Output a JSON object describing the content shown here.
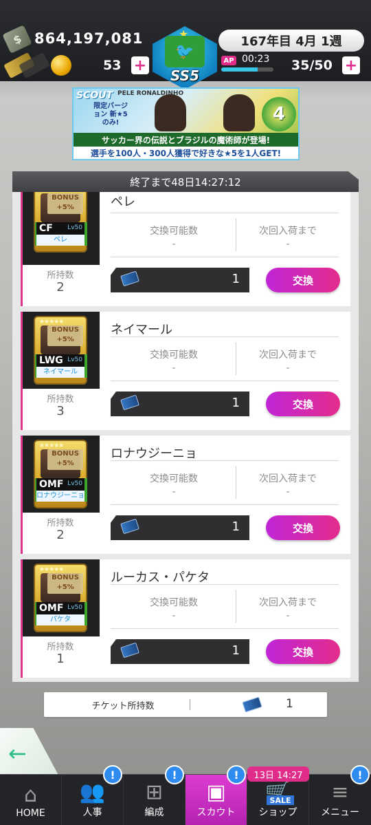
{
  "header": {
    "money": "864,197,081",
    "date": "167年目 4月 1週",
    "coins": "53",
    "ap_label": "AP",
    "ap_timer": "00:23",
    "ap_fraction": 0.7,
    "ap_value": "35/50",
    "emblem_label": "SS5",
    "plus_glyph": "+",
    "icons": {
      "money": "money-icon",
      "ticket": "ticket-icon",
      "coin": "coin-icon"
    }
  },
  "banner": {
    "scout_label": "SCOUT",
    "limited": "限定バージョン 新★5 のみ!",
    "names": "PELE   RONALDINHO",
    "anniversary": "4",
    "line1": "サッカー界の伝説とブラジルの魔術師が登場!",
    "line2": "選手を100人・300人獲得で好きな★5を1人GET!"
  },
  "timer": "終了まで48日14:27:12",
  "labels": {
    "exchangeable": "交換可能数",
    "next_restock": "次回入荷まで",
    "owned": "所持数",
    "exchange": "交換",
    "bonus": "BONUS",
    "bonus_pct": "+5%",
    "stars": "★★★★★"
  },
  "players": [
    {
      "name": "ペレ",
      "pos": "CF",
      "lv": "Lv50",
      "card_name": "ペレ",
      "exchangeable": "-",
      "next": "-",
      "owned": "2",
      "cost": "1"
    },
    {
      "name": "ネイマール",
      "pos": "LWG",
      "lv": "Lv50",
      "card_name": "ネイマール",
      "exchangeable": "-",
      "next": "-",
      "owned": "3",
      "cost": "1"
    },
    {
      "name": "ロナウジーニョ",
      "pos": "OMF",
      "lv": "Lv50",
      "card_name": "ロナウジーニョ",
      "exchangeable": "-",
      "next": "-",
      "owned": "2",
      "cost": "1"
    },
    {
      "name": "ルーカス・パケタ",
      "pos": "OMF",
      "lv": "Lv50",
      "card_name": "パケタ",
      "exchangeable": "-",
      "next": "-",
      "owned": "1",
      "cost": "1"
    }
  ],
  "footer": {
    "label": "チケット所持数",
    "value": "1"
  },
  "nav": {
    "back_glyph": "←",
    "items": [
      {
        "label": "HOME",
        "icon": "home-icon",
        "glyph": "⌂",
        "badge": ""
      },
      {
        "label": "人事",
        "icon": "people-icon",
        "glyph": "👥",
        "badge": "!"
      },
      {
        "label": "編成",
        "icon": "formation-icon",
        "glyph": "⊞",
        "badge": "!"
      },
      {
        "label": "スカウト",
        "icon": "scout-icon",
        "glyph": "▣",
        "badge": "!"
      },
      {
        "label": "ショップ",
        "icon": "cart-icon",
        "glyph": "🛒",
        "badge": ""
      },
      {
        "label": "メニュー",
        "icon": "menu-icon",
        "glyph": "≡",
        "badge": "!"
      }
    ],
    "sale_timer": "13日 14:27",
    "sale_tag": "SALE"
  }
}
